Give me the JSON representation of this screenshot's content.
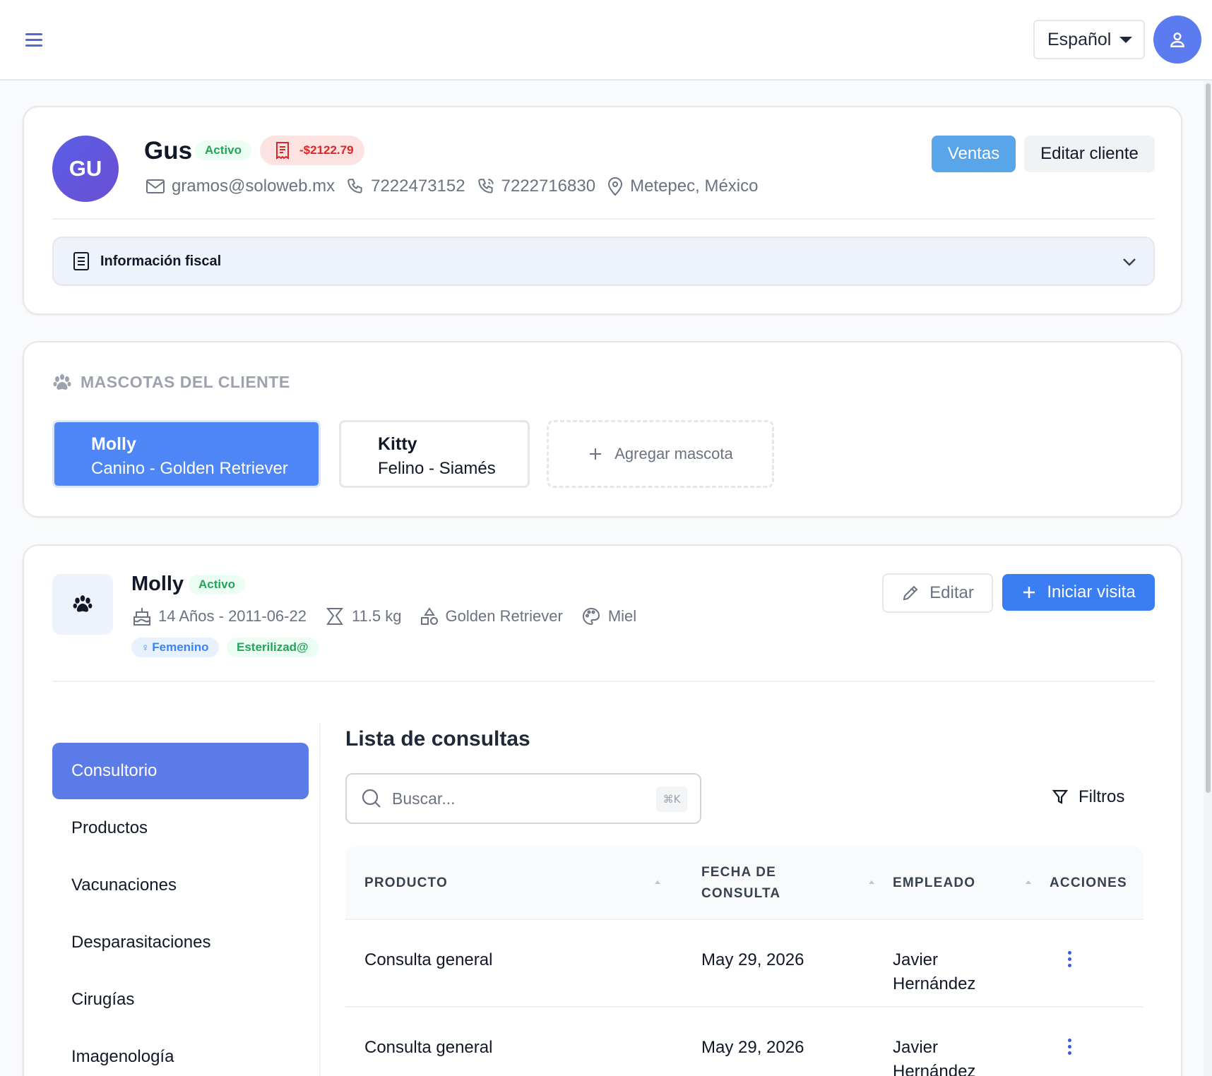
{
  "topbar": {
    "language": "Español"
  },
  "client": {
    "initials": "GU",
    "name": "Gus",
    "status": "Activo",
    "balance": "-$2122.79",
    "email": "gramos@soloweb.mx",
    "phone": "7222473152",
    "mobile": "7222716830",
    "location": "Metepec, México",
    "btn_sales": "Ventas",
    "btn_edit": "Editar cliente",
    "fiscal_label": "Información fiscal"
  },
  "pets": {
    "title": "MASCOTAS DEL CLIENTE",
    "items": [
      {
        "name": "Molly",
        "breed": "Canino - Golden Retriever"
      },
      {
        "name": "Kitty",
        "breed": "Felino - Siamés"
      }
    ],
    "add_label": "Agregar mascota"
  },
  "pet": {
    "name": "Molly",
    "status": "Activo",
    "age": "14 Años - 2011-06-22",
    "weight": "11.5 kg",
    "breed": "Golden Retriever",
    "color": "Miel",
    "sex": "Femenino",
    "sterilized": "Esterilizad@",
    "btn_edit": "Editar",
    "btn_start": "Iniciar visita"
  },
  "nav": {
    "items": [
      "Consultorio",
      "Productos",
      "Vacunaciones",
      "Desparasitaciones",
      "Cirugías",
      "Imagenología"
    ]
  },
  "consults": {
    "title": "Lista de consultas",
    "search_placeholder": "Buscar...",
    "shortcut": "⌘K",
    "filters": "Filtros",
    "headers": {
      "product": "PRODUCTO",
      "date_l1": "FECHA DE",
      "date_l2": "CONSULTA",
      "employee": "EMPLEADO",
      "actions": "ACCIONES"
    },
    "rows": [
      {
        "product": "Consulta general",
        "date": "May 29, 2026",
        "emp_first": "Javier",
        "emp_last": "Hernández"
      },
      {
        "product": "Consulta general",
        "date": "May 29, 2026",
        "emp_first": "Javier",
        "emp_last": "Hernández"
      }
    ]
  },
  "colors": {
    "primary": "#3b7df3",
    "nav_active": "#5a7be8",
    "success": "#22a559",
    "danger": "#dc2626"
  }
}
